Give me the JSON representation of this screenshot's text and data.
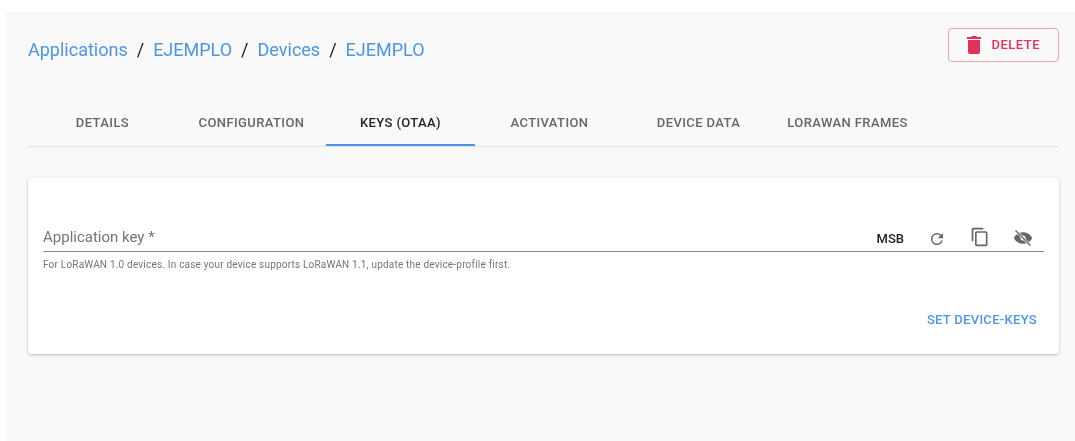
{
  "breadcrumb": [
    {
      "label": "Applications"
    },
    {
      "label": "EJEMPLO"
    },
    {
      "label": "Devices"
    },
    {
      "label": "EJEMPLO"
    }
  ],
  "breadcrumb_separator": "/",
  "delete_button": {
    "label": "DELETE"
  },
  "tabs": [
    {
      "label": "DETAILS",
      "selected": false
    },
    {
      "label": "CONFIGURATION",
      "selected": false
    },
    {
      "label": "KEYS (OTAA)",
      "selected": true
    },
    {
      "label": "ACTIVATION",
      "selected": false
    },
    {
      "label": "DEVICE DATA",
      "selected": false
    },
    {
      "label": "LORAWAN FRAMES",
      "selected": false
    }
  ],
  "form": {
    "field": {
      "label": "Application key *",
      "byte_order": "MSB",
      "helper": "For LoRaWAN 1.0 devices. In case your device supports LoRaWAN 1.1, update the device-profile first."
    },
    "submit": "SET DEVICE-KEYS"
  }
}
